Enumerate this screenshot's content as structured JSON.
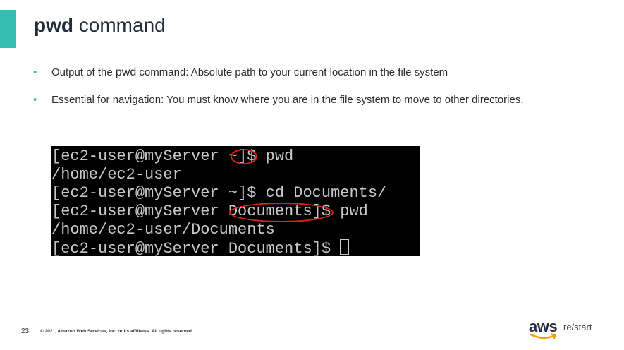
{
  "slide": {
    "title_command": "pwd",
    "title_rest": " command",
    "bullets": [
      {
        "before": "Output of the ",
        "command": "pwd",
        "after": " command: Absolute path to your current location in the file system"
      },
      {
        "text": "Essential for navigation: You must know where you are in the file system to move to other directories."
      }
    ],
    "bullet_glyph": "•"
  },
  "terminal": {
    "lines": [
      "[ec2-user@myServer ~]$ pwd",
      "/home/ec2-user",
      "[ec2-user@myServer ~]$ cd Documents/",
      "[ec2-user@myServer Documents]$ pwd",
      "/home/ec2-user/Documents",
      "[ec2-user@myServer Documents]$ "
    ],
    "highlighted": [
      "~",
      "Documents"
    ],
    "highlight_color": "#e0201a"
  },
  "footer": {
    "page_number": "23",
    "copyright": "© 2021, Amazon Web Services, Inc. or its affiliates. All rights reserved."
  },
  "logo": {
    "brand": "aws",
    "product": "re/start"
  },
  "colors": {
    "accent": "#33bfb0",
    "terminal_bg": "#000000",
    "terminal_text": "#c8c8c8",
    "aws_orange": "#ff9900"
  }
}
